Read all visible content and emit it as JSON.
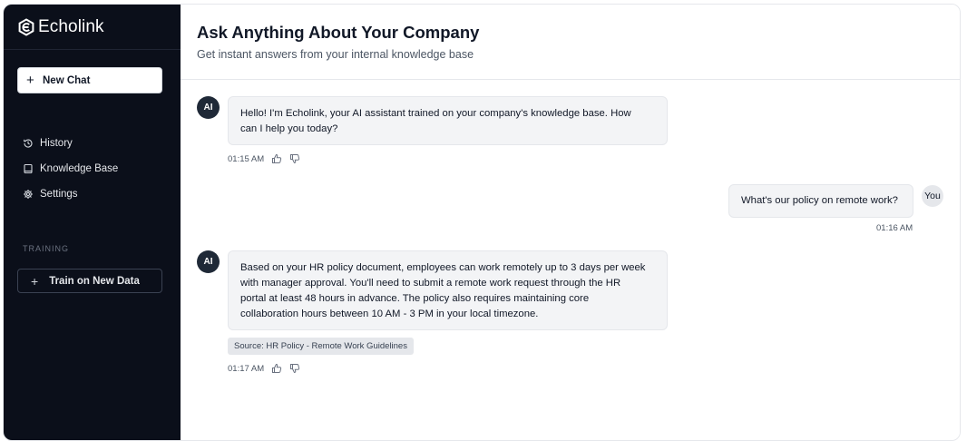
{
  "app": {
    "name": "Echolink"
  },
  "sidebar": {
    "new_chat_label": "New Chat",
    "nav": [
      {
        "label": "History",
        "icon": "history-icon"
      },
      {
        "label": "Knowledge Base",
        "icon": "book-icon"
      },
      {
        "label": "Settings",
        "icon": "gear-icon"
      }
    ],
    "section_label": "TRAINING",
    "train_label": "Train on New Data"
  },
  "header": {
    "title": "Ask Anything About Your Company",
    "subtitle": "Get instant answers from your internal knowledge base"
  },
  "messages": [
    {
      "role": "ai",
      "avatar": "AI",
      "lines": [
        "Hello! I'm Echolink, your AI assistant trained on your company's knowledge base. How",
        "can I help you today?"
      ],
      "time": "01:15 AM"
    },
    {
      "role": "user",
      "avatar": "You",
      "lines": [
        "What's our policy on remote work?"
      ],
      "time": "01:16 AM"
    },
    {
      "role": "ai",
      "avatar": "AI",
      "lines": [
        "Based on your HR policy document, employees can work remotely up to 3 days per week",
        "with manager approval. You'll need to submit a remote work request through the HR",
        "portal at least 48 hours in advance. The policy also requires maintaining core",
        "collaboration hours between 10 AM - 3 PM in your local timezone."
      ],
      "source": "Source: HR Policy - Remote Work Guidelines",
      "time": "01:17 AM"
    }
  ],
  "colors": {
    "sidebar_bg": "#0b0f1a",
    "bubble_bg": "#f3f4f6",
    "avatar_ai_bg": "#1f2937"
  }
}
